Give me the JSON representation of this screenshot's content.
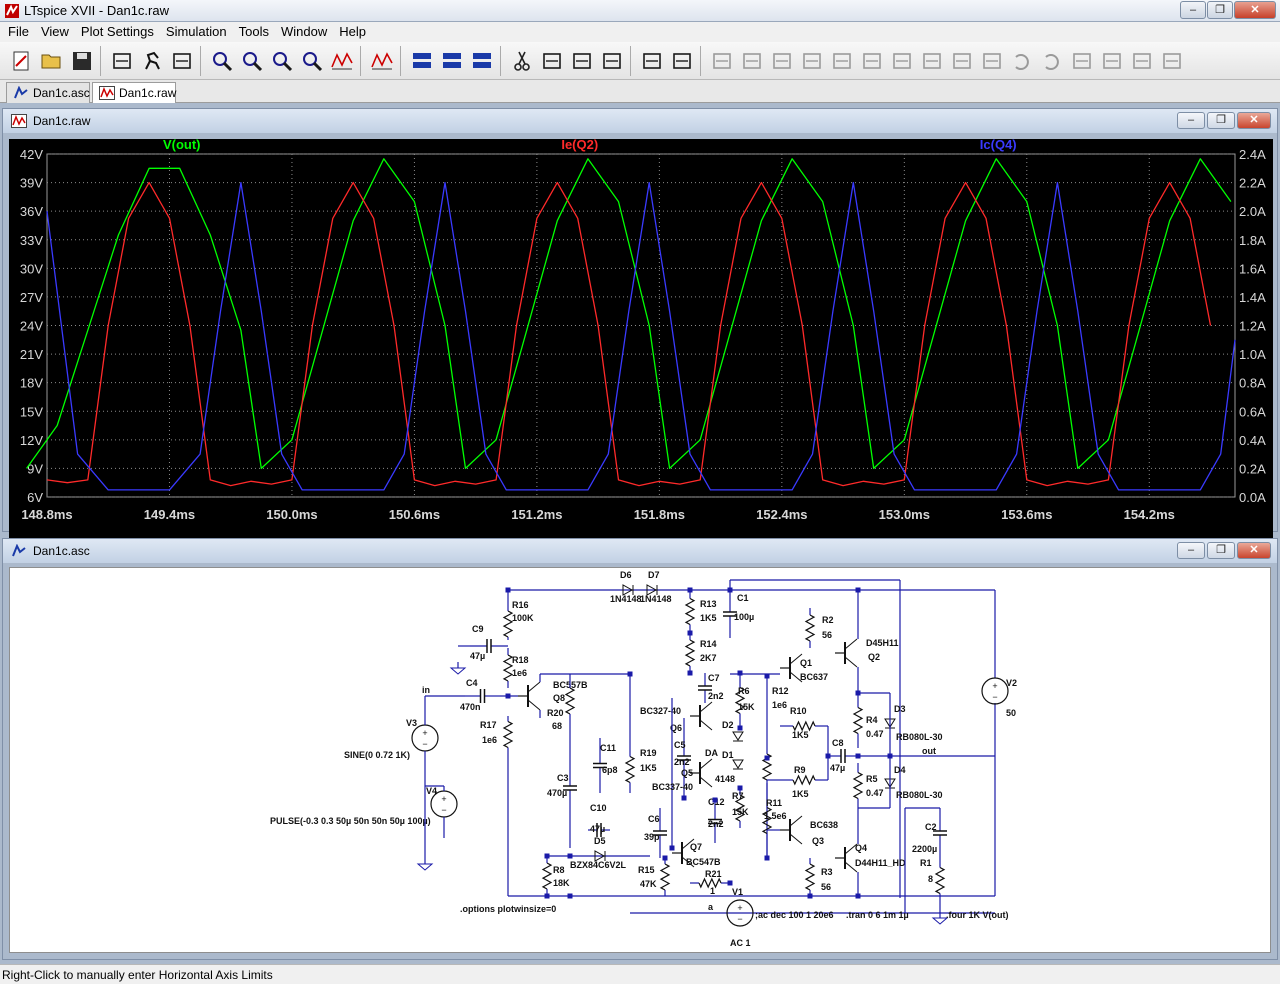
{
  "window": {
    "title": "LTspice XVII - Dan1c.raw"
  },
  "menu": [
    "File",
    "View",
    "Plot Settings",
    "Simulation",
    "Tools",
    "Window",
    "Help"
  ],
  "toolbar": [
    "new-schematic",
    "open",
    "save",
    "control-panel",
    "run",
    "halt",
    "zoom-area",
    "zoom-in",
    "zoom-out",
    "zoom-fit",
    "autorange",
    "pick-traces",
    "tile-horizontal",
    "cascade",
    "tile-vertical",
    "cut",
    "copy",
    "paste",
    "find",
    "print-preview",
    "print",
    "wire",
    "ground",
    "label-net",
    "resistor",
    "capacitor",
    "inductor",
    "diode",
    "component",
    "move",
    "drag",
    "undo",
    "redo",
    "rotate",
    "mirror",
    "text",
    "spice-directive"
  ],
  "doc_tabs": [
    {
      "label": "Dan1c.asc",
      "active": false
    },
    {
      "label": "Dan1c.raw",
      "active": true
    }
  ],
  "plot_window": {
    "title": "Dan1c.raw"
  },
  "schematic_window": {
    "title": "Dan1c.asc"
  },
  "status": "Right-Click to manually enter Horizontal Axis Limits",
  "chart_data": {
    "type": "line",
    "title": "",
    "series": [
      {
        "name": "V(out)",
        "axis": "left",
        "color": "#00ff00",
        "x": [
          148.7,
          148.85,
          149.0,
          149.15,
          149.3,
          149.45,
          149.6,
          149.75,
          149.85,
          150.0,
          150.15,
          150.3,
          150.45,
          150.6,
          150.75,
          150.85,
          151.0,
          151.15,
          151.3,
          151.45,
          151.6,
          151.75,
          151.85,
          152.0,
          152.15,
          152.3,
          152.45,
          152.6,
          152.75,
          152.85,
          153.0,
          153.15,
          153.3,
          153.45,
          153.6,
          153.75,
          153.85,
          154.0,
          154.15,
          154.3,
          154.45,
          154.6
        ],
        "y": [
          9.0,
          13.5,
          23.5,
          33.5,
          40.5,
          40.5,
          33.5,
          23.5,
          9.0,
          12.0,
          23.5,
          35.0,
          41.5,
          37.0,
          24.0,
          9.0,
          12.0,
          23.5,
          35.0,
          41.5,
          37.0,
          24.0,
          9.0,
          12.0,
          23.5,
          35.0,
          41.5,
          37.0,
          24.0,
          9.0,
          12.0,
          23.5,
          35.0,
          41.5,
          37.0,
          24.0,
          9.0,
          12.0,
          23.5,
          35.0,
          41.5,
          37.0
        ]
      },
      {
        "name": "Ie(Q2)",
        "axis": "right",
        "color": "#ff2a2a",
        "x": [
          148.8,
          148.9,
          149.0,
          149.1,
          149.2,
          149.3,
          149.4,
          149.5,
          149.6,
          149.7,
          149.8,
          149.9,
          150.0,
          150.1,
          150.2,
          150.3,
          150.4,
          150.5,
          150.6,
          150.7,
          150.8,
          150.9,
          151.0,
          151.1,
          151.2,
          151.3,
          151.4,
          151.5,
          151.6,
          151.7,
          151.8,
          151.9,
          152.0,
          152.1,
          152.2,
          152.3,
          152.4,
          152.5,
          152.6,
          152.7,
          152.8,
          152.9,
          153.0,
          153.1,
          153.2,
          153.3,
          153.4,
          153.5,
          153.6,
          153.7,
          153.8,
          153.9,
          154.0,
          154.1,
          154.2,
          154.3,
          154.4,
          154.5
        ],
        "y": [
          0.12,
          0.1,
          0.12,
          1.2,
          1.95,
          2.2,
          1.95,
          1.2,
          0.12,
          0.08,
          0.11,
          0.09,
          0.12,
          1.2,
          1.95,
          2.2,
          1.95,
          1.2,
          0.12,
          0.08,
          0.11,
          0.09,
          0.12,
          1.2,
          1.95,
          2.2,
          1.95,
          1.2,
          0.12,
          0.08,
          0.11,
          0.09,
          0.12,
          1.2,
          1.95,
          2.2,
          1.95,
          1.2,
          0.12,
          0.08,
          0.11,
          0.09,
          0.12,
          1.2,
          1.95,
          2.2,
          1.95,
          1.2,
          0.12,
          0.08,
          0.11,
          0.09,
          0.12,
          1.2,
          1.95,
          2.2,
          1.95,
          1.2
        ]
      },
      {
        "name": "Ic(Q4)",
        "axis": "right",
        "color": "#3a3aff",
        "x": [
          148.8,
          148.95,
          149.1,
          149.25,
          149.4,
          149.55,
          149.65,
          149.75,
          149.85,
          149.95,
          150.05,
          150.15,
          150.25,
          150.35,
          150.45,
          150.55,
          150.65,
          150.75,
          150.85,
          150.95,
          151.05,
          151.15,
          151.25,
          151.35,
          151.45,
          151.55,
          151.65,
          151.75,
          151.85,
          151.95,
          152.05,
          152.15,
          152.25,
          152.35,
          152.45,
          152.55,
          152.65,
          152.75,
          152.85,
          152.95,
          153.05,
          153.15,
          153.25,
          153.35,
          153.45,
          153.55,
          153.65,
          153.75,
          153.85,
          153.95,
          154.05,
          154.15,
          154.25,
          154.35,
          154.45,
          154.55,
          154.62
        ],
        "y": [
          2.0,
          0.3,
          0.05,
          0.05,
          0.05,
          0.3,
          1.3,
          2.2,
          1.3,
          0.3,
          0.05,
          0.05,
          0.05,
          0.05,
          0.05,
          0.3,
          1.3,
          2.2,
          1.3,
          0.3,
          0.05,
          0.05,
          0.05,
          0.05,
          0.05,
          0.3,
          1.3,
          2.2,
          1.3,
          0.3,
          0.05,
          0.05,
          0.05,
          0.05,
          0.05,
          0.3,
          1.3,
          2.2,
          1.3,
          0.3,
          0.05,
          0.05,
          0.05,
          0.05,
          0.05,
          0.3,
          1.3,
          2.2,
          1.3,
          0.3,
          0.05,
          0.05,
          0.05,
          0.05,
          0.05,
          0.3,
          1.1
        ]
      }
    ],
    "x_ticks": [
      "148.8ms",
      "149.4ms",
      "150.0ms",
      "150.6ms",
      "151.2ms",
      "151.8ms",
      "152.4ms",
      "153.0ms",
      "153.6ms",
      "154.2ms"
    ],
    "x_tick_values": [
      148.8,
      149.4,
      150.0,
      150.6,
      151.2,
      151.8,
      152.4,
      153.0,
      153.6,
      154.2
    ],
    "xlim": [
      148.8,
      154.62
    ],
    "y_left_ticks": [
      "6V",
      "9V",
      "12V",
      "15V",
      "18V",
      "21V",
      "24V",
      "27V",
      "30V",
      "33V",
      "36V",
      "39V",
      "42V"
    ],
    "ylim_left": [
      6,
      42
    ],
    "y_right_ticks": [
      "0.0A",
      "0.2A",
      "0.4A",
      "0.6A",
      "0.8A",
      "1.0A",
      "1.2A",
      "1.4A",
      "1.6A",
      "1.8A",
      "2.0A",
      "2.2A",
      "2.4A"
    ],
    "ylim_right": [
      0,
      2.4
    ],
    "grid": true,
    "legend": "top"
  },
  "schematic": {
    "labels": {
      "D6": "D6",
      "D7": "D7",
      "D6m": "1N4148",
      "D7m": "1N4148",
      "R16": "R16",
      "R16v": "100K",
      "C9": "C9",
      "C9v": "47µ",
      "R18": "R18",
      "R18v": "1e6",
      "in": "in",
      "C4": "C4",
      "C4v": "470n",
      "R17": "R17",
      "R17v": "1e6",
      "V3": "V3",
      "V3v": "SINE(0 0.72 1K)",
      "V4": "V4",
      "V4v": "PULSE(-0.3 0.3 50µ 50n 50n 50µ 100µ)",
      "Q8m": "BC557B",
      "Q8": "Q8",
      "R20": "R20",
      "R20v": "68",
      "C3": "C3",
      "C3v": "470µ",
      "C11": "C11",
      "C11v": "6p8",
      "R19": "R19",
      "R19v": "1K5",
      "C10": "C10",
      "C10v": "47µ",
      "D5": "D5",
      "D5m": "BZX84C6V2L",
      "R8": "R8",
      "R8v": "18K",
      "opts": ".options plotwinsize=0",
      "R13": "R13",
      "R13v": "1K5",
      "C1": "C1",
      "C1v": "100µ",
      "R14": "R14",
      "R14v": "2K7",
      "C7": "C7",
      "C7v": "2n2",
      "Q6m": "BC327-40",
      "Q6": "Q6",
      "R6": "R6",
      "R6v": "15K",
      "R12": "R12",
      "R12v": "1e6",
      "C5": "C5",
      "C5v": "2n2",
      "D2": "D2",
      "D1": "D1",
      "DA": "DA",
      "D1m": "4148",
      "Q5": "Q5",
      "Q5m": "BC337-40",
      "R7": "R7",
      "R7v": "15K",
      "C12": "C12",
      "C12v": "2n2",
      "C6": "C6",
      "C6v": "39p",
      "Q7": "Q7",
      "Q7m": "BC547B",
      "R15": "R15",
      "R15v": "47K",
      "R21": "R21",
      "R21v": "1",
      "R11": "R11",
      "R11v": "1.5e6",
      "R10": "R10",
      "R10v": "1K5",
      "R9": "R9",
      "R9v": "1K5",
      "R2": "R2",
      "R2v": "56",
      "Q1": "Q1",
      "Q1m": "BC637",
      "Q2m": "D45H11",
      "Q2": "Q2",
      "R4": "R4",
      "R4v": "0.47",
      "D3": "D3",
      "D3m": "RB080L-30",
      "C8": "C8",
      "C8v": "47µ",
      "out": "out",
      "R5": "R5",
      "R5v": "0.47",
      "D4": "D4",
      "D4m": "RB080L-30",
      "Q3m": "BC638",
      "Q3": "Q3",
      "Q4": "Q4",
      "Q4m": "D44H11_HD",
      "R3": "R3",
      "R3v": "56",
      "V2": "V2",
      "V2v": "50",
      "C2": "C2",
      "C2v": "2200µ",
      "R1": "R1",
      "R1v": "8",
      "V1": "V1",
      "a": "a",
      "V1v": "AC 1",
      "ac": ";ac dec 100 1 20e6",
      "tran": ".tran 0 6 1m 1µ",
      "four": ".four 1K V(out)"
    }
  }
}
